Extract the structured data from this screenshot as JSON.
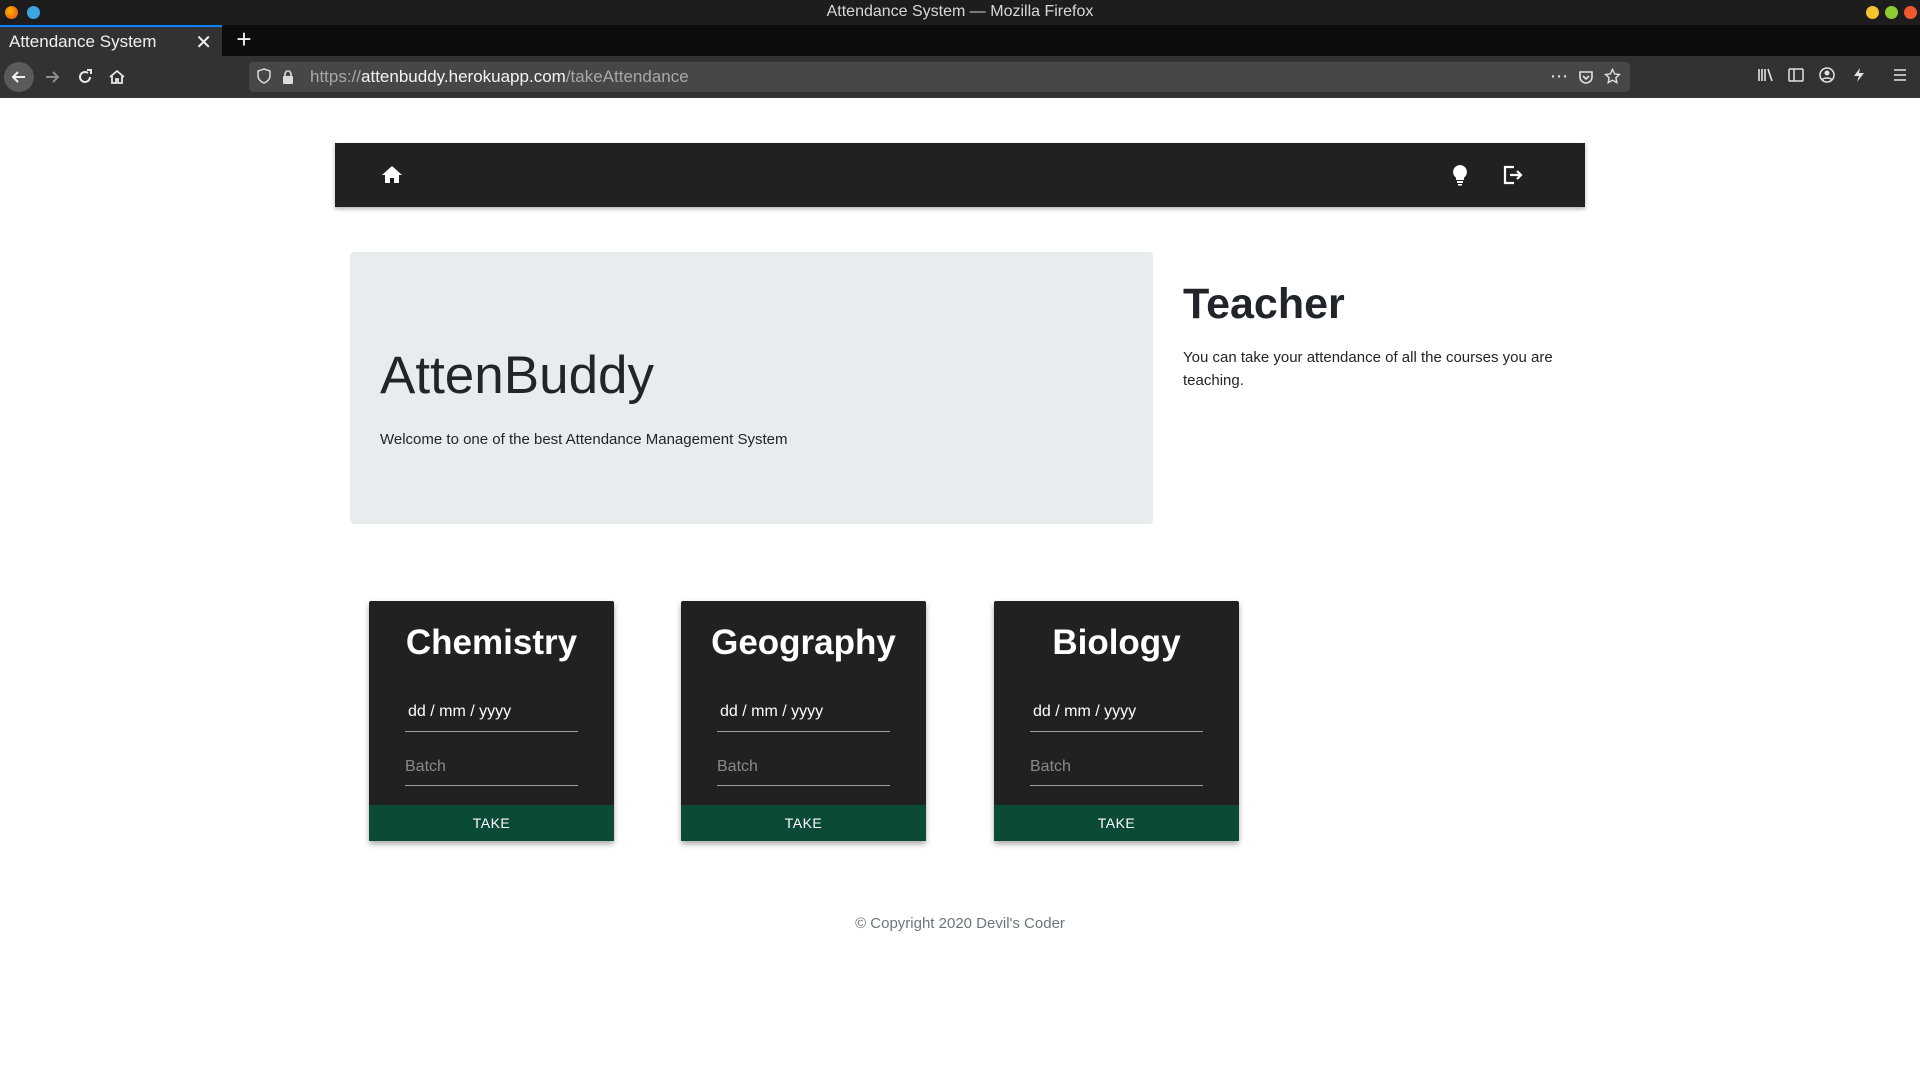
{
  "browser": {
    "window_title": "Attendance System — Mozilla Firefox",
    "tab_title": "Attendance System",
    "tab_close": "✕",
    "new_tab": "+",
    "url_scheme": "https://",
    "url_host": "attenbuddy.herokuapp.com",
    "url_path": "/takeAttendance"
  },
  "icons": {
    "back": "arrow-left-icon",
    "forward": "arrow-right-icon",
    "reload": "reload-icon",
    "home": "home-icon",
    "bulb": "lightbulb-icon",
    "logout": "sign-out-icon"
  },
  "colors": {
    "navbar": "#212121",
    "jumbotron": "#e9ecef",
    "card": "#212121",
    "take_button": "#0c4a38"
  },
  "hero": {
    "title": "AttenBuddy",
    "subtitle": "Welcome to one of the best Attendance Management System"
  },
  "role": {
    "title": "Teacher",
    "description": "You can take your attendance of all the courses you are teaching."
  },
  "courses": [
    {
      "name": "Chemistry",
      "date_placeholder": "dd / mm / yyyy",
      "batch_placeholder": "Batch",
      "button": "TAKE"
    },
    {
      "name": "Geography",
      "date_placeholder": "dd / mm / yyyy",
      "batch_placeholder": "Batch",
      "button": "TAKE"
    },
    {
      "name": "Biology",
      "date_placeholder": "dd / mm / yyyy",
      "batch_placeholder": "Batch",
      "button": "TAKE"
    }
  ],
  "footer": {
    "copyright": "© Copyright 2020 Devil's Coder"
  }
}
